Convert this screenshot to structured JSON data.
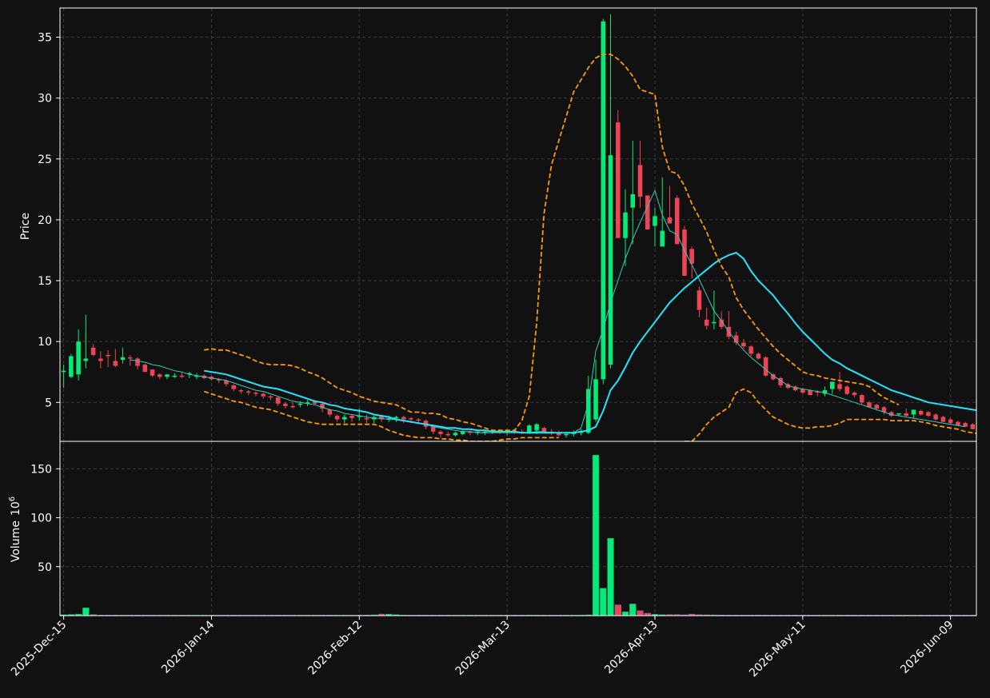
{
  "chart_data": {
    "type": "candlestick",
    "x_axis": {
      "tick_labels": [
        "2025-Dec-15",
        "2026-Jan-14",
        "2026-Feb-12",
        "2026-Mar-13",
        "2026-Apr-13",
        "2026-May-11",
        "2026-Jun-09"
      ],
      "tick_positions": [
        0,
        20,
        40,
        60,
        80,
        100,
        120
      ],
      "count": 124,
      "xlim": [
        -0.5,
        123.5
      ]
    },
    "price_panel": {
      "ylabel": "Price",
      "ylim": [
        1.8,
        37.4
      ],
      "yticks": [
        5,
        10,
        15,
        20,
        25,
        30,
        35
      ],
      "grid": true
    },
    "volume_panel": {
      "ylabel": "Volume",
      "ylabel_exponent": "10",
      "ylabel_power": "6",
      "ylim": [
        0,
        178
      ],
      "yticks": [
        50,
        100,
        150
      ],
      "grid": true
    },
    "colors": {
      "background": "#111111",
      "up": "#00ee77",
      "down": "#ee4455",
      "ma_slow": "#22e5ff",
      "ma_fast": "#33ccbb",
      "band": "#ff9900",
      "grid": "#3a3a3a",
      "axis": "#ffffff"
    },
    "ohlc_open": [
      7.5,
      7.1,
      7.3,
      8.4,
      9.5,
      8.6,
      8.9,
      8.4,
      8.5,
      8.7,
      8.6,
      8.1,
      7.7,
      7.3,
      7.1,
      7.2,
      7.2,
      7.3,
      7.1,
      7.2,
      7.1,
      6.9,
      6.8,
      6.4,
      6.0,
      5.9,
      5.8,
      5.7,
      5.5,
      5.4,
      4.9,
      4.7,
      4.8,
      4.9,
      5.1,
      4.9,
      4.4,
      3.9,
      3.6,
      3.9,
      3.8,
      3.7,
      3.6,
      3.9,
      3.6,
      3.7,
      3.8,
      3.7,
      3.6,
      3.5,
      3.0,
      2.6,
      2.4,
      2.3,
      2.4,
      2.6,
      2.5,
      2.5,
      2.6,
      2.7,
      2.6,
      2.7,
      2.6,
      2.5,
      2.7,
      2.9,
      2.6,
      2.5,
      2.3,
      2.4,
      2.5,
      2.5,
      3.6,
      6.9,
      8.1,
      28.0,
      18.5,
      21.0,
      24.5,
      22.0,
      19.5,
      17.8,
      20.2,
      21.8,
      19.2,
      17.6,
      14.2,
      11.8,
      11.5,
      11.8,
      11.2,
      10.5,
      9.9,
      9.6,
      9.0,
      8.7,
      7.3,
      7.0,
      6.5,
      6.3,
      6.1,
      6.0,
      5.9,
      5.7,
      6.1,
      6.5,
      6.3,
      5.8,
      5.6,
      5.0,
      4.8,
      4.6,
      4.2,
      4.0,
      4.1,
      4.0,
      4.3,
      4.2,
      4.0,
      3.8,
      3.6,
      3.4,
      3.3,
      3.2
    ],
    "ohlc_high": [
      8.1,
      9.0,
      11.0,
      12.2,
      9.8,
      9.2,
      9.3,
      9.4,
      9.5,
      8.9,
      8.7,
      8.2,
      7.7,
      7.4,
      7.3,
      7.4,
      7.5,
      7.5,
      7.4,
      7.3,
      7.2,
      7.0,
      6.9,
      6.5,
      6.1,
      6.0,
      5.9,
      5.8,
      5.6,
      5.5,
      5.0,
      5.0,
      5.1,
      5.2,
      5.2,
      5.0,
      4.5,
      4.0,
      4.0,
      4.0,
      4.5,
      4.0,
      3.9,
      4.0,
      3.9,
      3.9,
      3.9,
      3.8,
      3.7,
      3.6,
      3.1,
      2.7,
      2.6,
      2.6,
      2.7,
      2.7,
      2.7,
      2.7,
      2.8,
      2.8,
      2.8,
      2.8,
      2.8,
      3.2,
      3.3,
      3.0,
      2.8,
      2.7,
      2.6,
      2.7,
      2.8,
      7.2,
      8.5,
      36.5,
      36.9,
      29.0,
      22.5,
      26.5,
      26.5,
      21.5,
      21.0,
      23.5,
      22.8,
      22.0,
      19.5,
      17.8,
      14.5,
      12.8,
      14.2,
      12.5,
      12.5,
      10.8,
      10.2,
      9.7,
      9.1,
      8.8,
      7.4,
      7.1,
      6.6,
      6.4,
      6.2,
      6.1,
      6.0,
      6.3,
      6.7,
      7.5,
      6.4,
      5.9,
      5.7,
      5.1,
      4.9,
      4.7,
      4.3,
      4.1,
      4.5,
      4.4,
      4.4,
      4.3,
      4.1,
      3.9,
      3.7,
      3.5,
      3.4,
      3.3
    ],
    "ohlc_low": [
      6.2,
      7.0,
      6.8,
      7.8,
      8.8,
      7.8,
      7.9,
      7.9,
      8.2,
      8.0,
      7.7,
      7.5,
      7.1,
      6.9,
      6.9,
      7.0,
      7.0,
      7.0,
      6.9,
      6.9,
      6.8,
      6.6,
      6.3,
      5.9,
      5.7,
      5.6,
      5.5,
      5.3,
      5.2,
      4.7,
      4.5,
      4.5,
      4.6,
      4.7,
      4.8,
      4.2,
      3.8,
      3.4,
      3.3,
      3.4,
      3.5,
      3.3,
      3.3,
      3.4,
      3.4,
      3.4,
      3.3,
      3.3,
      3.2,
      2.8,
      2.4,
      2.1,
      2.2,
      2.2,
      2.3,
      2.3,
      2.3,
      2.3,
      2.4,
      2.4,
      2.3,
      2.4,
      2.4,
      2.4,
      2.4,
      2.5,
      2.3,
      2.2,
      2.1,
      2.2,
      2.3,
      2.4,
      3.4,
      6.5,
      7.8,
      24.5,
      16.2,
      18.0,
      21.0,
      19.2,
      17.8,
      17.8,
      19.8,
      18.8,
      17.4,
      15.2,
      12.0,
      11.0,
      11.0,
      11.0,
      10.2,
      9.7,
      9.4,
      8.8,
      8.5,
      7.1,
      6.8,
      6.2,
      6.1,
      5.9,
      5.7,
      5.6,
      5.5,
      5.5,
      5.7,
      5.9,
      5.6,
      5.4,
      4.8,
      4.6,
      4.4,
      4.0,
      3.8,
      3.9,
      3.8,
      3.7,
      3.9,
      3.8,
      3.5,
      3.4,
      3.2,
      3.1,
      3.0,
      2.9
    ],
    "ohlc_close": [
      7.6,
      8.8,
      10.0,
      8.6,
      8.9,
      8.4,
      8.8,
      8.0,
      8.7,
      8.6,
      8.0,
      7.5,
      7.2,
      7.1,
      7.3,
      7.2,
      7.1,
      7.4,
      7.2,
      7.0,
      6.9,
      6.8,
      6.5,
      6.1,
      5.9,
      5.8,
      5.7,
      5.5,
      5.4,
      4.9,
      4.7,
      4.6,
      4.9,
      5.0,
      4.9,
      4.5,
      4.0,
      3.6,
      3.8,
      3.7,
      3.9,
      3.6,
      3.8,
      3.6,
      3.7,
      3.8,
      3.6,
      3.6,
      3.5,
      3.0,
      2.6,
      2.4,
      2.3,
      2.5,
      2.6,
      2.5,
      2.6,
      2.6,
      2.7,
      2.6,
      2.7,
      2.6,
      2.5,
      3.1,
      3.2,
      2.6,
      2.5,
      2.3,
      2.4,
      2.5,
      2.6,
      6.1,
      6.9,
      36.3,
      25.3,
      18.5,
      20.6,
      22.1,
      21.9,
      19.2,
      20.3,
      19.1,
      19.7,
      18.0,
      15.4,
      16.4,
      12.6,
      11.3,
      11.6,
      11.2,
      10.4,
      9.9,
      9.6,
      9.0,
      8.6,
      7.2,
      6.9,
      6.4,
      6.2,
      6.0,
      5.8,
      5.6,
      5.8,
      6.0,
      6.7,
      6.1,
      5.7,
      5.6,
      5.0,
      4.6,
      4.5,
      4.2,
      3.9,
      4.1,
      3.9,
      4.4,
      4.0,
      3.9,
      3.6,
      3.4,
      3.3,
      3.1,
      3.0,
      2.8
    ],
    "volume": [
      1.0,
      1.2,
      1.5,
      8.0,
      1.0,
      0.5,
      0.5,
      0.5,
      0.5,
      0.4,
      0.4,
      0.3,
      0.3,
      0.3,
      0.3,
      0.3,
      0.3,
      0.3,
      0.3,
      0.3,
      0.3,
      0.3,
      0.3,
      0.3,
      0.3,
      0.3,
      0.3,
      0.3,
      0.3,
      0.3,
      0.3,
      0.3,
      0.3,
      0.3,
      0.3,
      0.3,
      0.3,
      0.3,
      0.3,
      0.3,
      0.5,
      0.6,
      0.8,
      1.6,
      1.5,
      1.0,
      0.6,
      0.5,
      0.5,
      0.5,
      0.5,
      0.5,
      0.5,
      0.5,
      0.5,
      0.5,
      0.5,
      0.5,
      0.5,
      0.5,
      0.5,
      0.5,
      0.5,
      0.6,
      0.6,
      0.5,
      0.5,
      0.5,
      0.5,
      0.5,
      0.6,
      0.8,
      164.0,
      28.0,
      79.0,
      11.0,
      4.0,
      12.0,
      5.0,
      2.5,
      1.5,
      1.0,
      1.0,
      1.0,
      0.8,
      1.5,
      0.9,
      0.8,
      0.7,
      0.6,
      0.5,
      0.5,
      0.5,
      0.5,
      0.6,
      0.5,
      0.5,
      0.5,
      0.5,
      0.5,
      0.5,
      0.5,
      0.5,
      0.5,
      0.5,
      0.5,
      0.5,
      0.5,
      0.5,
      0.5,
      0.5,
      0.5,
      0.5,
      0.5,
      0.5,
      0.5,
      0.5,
      0.5,
      0.5,
      0.5,
      0.5,
      0.5,
      0.5,
      0.5
    ],
    "series": [
      {
        "key": "ma_fast",
        "style": "solid-thin",
        "start": 9,
        "values": [
          8.5,
          8.4,
          8.3,
          8.1,
          8.0,
          7.8,
          7.6,
          7.5,
          7.3,
          7.2,
          7.1,
          7.0,
          6.9,
          6.8,
          6.6,
          6.4,
          6.2,
          6.0,
          5.9,
          5.7,
          5.5,
          5.3,
          5.1,
          5.0,
          4.9,
          4.8,
          4.6,
          4.4,
          4.3,
          4.1,
          4.0,
          3.9,
          3.8,
          3.7,
          3.7,
          3.6,
          3.6,
          3.5,
          3.4,
          3.3,
          3.2,
          3.0,
          2.9,
          2.8,
          2.7,
          2.6,
          2.6,
          2.5,
          2.5,
          2.5,
          2.5,
          2.5,
          2.5,
          2.5,
          2.5,
          2.6,
          2.6,
          2.5,
          2.5,
          2.5,
          2.5,
          2.9,
          4.9,
          9.2,
          11.0,
          13.2,
          15.0,
          16.8,
          18.4,
          19.8,
          21.1,
          22.4,
          20.4,
          19.1,
          18.8,
          17.5,
          16.3,
          15.1,
          13.8,
          12.5,
          11.7,
          10.8,
          10.0,
          9.3,
          8.7,
          8.2,
          7.7,
          7.2,
          6.8,
          6.4,
          6.2,
          6.1,
          6.0,
          5.9,
          5.8,
          5.6,
          5.4,
          5.2,
          5.0,
          4.8,
          4.6,
          4.4,
          4.2,
          4.0,
          3.9,
          3.8,
          3.7,
          3.6,
          3.5,
          3.4,
          3.3,
          3.2,
          3.1,
          3.0
        ]
      },
      {
        "key": "ma_slow",
        "style": "solid",
        "start": 19,
        "values": [
          7.6,
          7.5,
          7.4,
          7.3,
          7.1,
          6.9,
          6.7,
          6.5,
          6.3,
          6.2,
          6.1,
          5.9,
          5.7,
          5.5,
          5.3,
          5.1,
          5.0,
          4.8,
          4.7,
          4.5,
          4.4,
          4.3,
          4.2,
          4.0,
          3.9,
          3.8,
          3.6,
          3.5,
          3.4,
          3.3,
          3.2,
          3.1,
          3.0,
          2.9,
          2.9,
          2.8,
          2.8,
          2.7,
          2.7,
          2.6,
          2.6,
          2.6,
          2.6,
          2.5,
          2.5,
          2.5,
          2.5,
          2.5,
          2.5,
          2.5,
          2.5,
          2.6,
          2.7,
          3.0,
          4.3,
          6.0,
          6.8,
          7.9,
          9.1,
          10.0,
          10.8,
          11.6,
          12.4,
          13.2,
          13.8,
          14.4,
          14.9,
          15.4,
          15.9,
          16.4,
          16.8,
          17.1,
          17.3,
          16.8,
          15.8,
          15.0,
          14.4,
          13.8,
          13.0,
          12.3,
          11.5,
          10.8,
          10.2,
          9.6,
          9.0,
          8.5,
          8.2,
          7.8,
          7.5,
          7.2,
          6.9,
          6.6,
          6.3,
          6.0,
          5.8,
          5.6,
          5.4,
          5.2,
          5.0,
          4.9,
          4.8,
          4.7,
          4.6,
          4.5,
          4.4,
          4.3,
          4.2,
          4.1,
          3.9,
          3.8,
          3.7,
          3.6,
          3.5
        ]
      },
      {
        "key": "band_upper",
        "style": "dashed",
        "start": 19,
        "values": [
          9.3,
          9.4,
          9.3,
          9.3,
          9.1,
          8.9,
          8.7,
          8.4,
          8.2,
          8.1,
          8.1,
          8.1,
          8.0,
          7.8,
          7.5,
          7.3,
          7.0,
          6.6,
          6.2,
          6.0,
          5.8,
          5.5,
          5.3,
          5.1,
          5.0,
          4.9,
          4.8,
          4.5,
          4.2,
          4.2,
          4.1,
          4.1,
          4.0,
          3.7,
          3.6,
          3.4,
          3.3,
          3.1,
          2.9,
          2.7,
          2.7,
          2.7,
          2.7,
          3.5,
          5.5,
          11.5,
          20.5,
          24.5,
          26.5,
          28.5,
          30.5,
          31.5,
          32.5,
          33.3,
          33.6,
          33.6,
          33.2,
          32.6,
          31.8,
          30.7,
          30.5,
          30.3,
          26.0,
          24.0,
          23.8,
          22.8,
          21.3,
          20.2,
          19.0,
          17.5,
          16.2,
          15.3,
          13.6,
          12.6,
          11.8,
          11.0,
          10.3,
          9.6,
          9.0,
          8.5,
          8.0,
          7.5,
          7.3,
          7.2,
          7.0,
          6.9,
          6.8,
          6.7,
          6.6,
          6.5,
          6.3,
          5.8,
          5.4,
          5.1,
          4.8
        ]
      },
      {
        "key": "band_lower",
        "style": "dashed",
        "start": 19,
        "values": [
          5.9,
          5.7,
          5.5,
          5.3,
          5.1,
          5.0,
          4.8,
          4.6,
          4.5,
          4.4,
          4.2,
          4.0,
          3.8,
          3.6,
          3.4,
          3.3,
          3.2,
          3.2,
          3.2,
          3.2,
          3.2,
          3.2,
          3.2,
          3.2,
          3.0,
          2.7,
          2.5,
          2.3,
          2.2,
          2.1,
          2.1,
          2.1,
          2.0,
          2.0,
          1.9,
          1.9,
          1.8,
          1.8,
          1.8,
          1.8,
          1.9,
          2.0,
          2.0,
          2.1,
          2.1,
          2.1,
          2.1,
          2.1,
          2.1
        ]
      },
      {
        "key": "band_lower",
        "style": "dashed",
        "start": 84,
        "values": [
          1.8,
          1.8,
          2.4,
          3.2,
          3.8,
          4.2,
          4.6,
          5.8,
          6.1,
          5.8,
          5.0,
          4.4,
          3.8,
          3.5,
          3.2,
          3.0,
          2.9,
          2.9,
          3.0,
          3.0,
          3.1,
          3.3,
          3.6,
          3.6,
          3.6,
          3.6,
          3.6,
          3.6,
          3.5,
          3.5,
          3.5,
          3.5,
          3.4,
          3.3,
          3.1,
          3.0,
          2.9,
          2.8,
          2.6,
          2.5,
          2.4,
          2.3
        ]
      }
    ]
  }
}
